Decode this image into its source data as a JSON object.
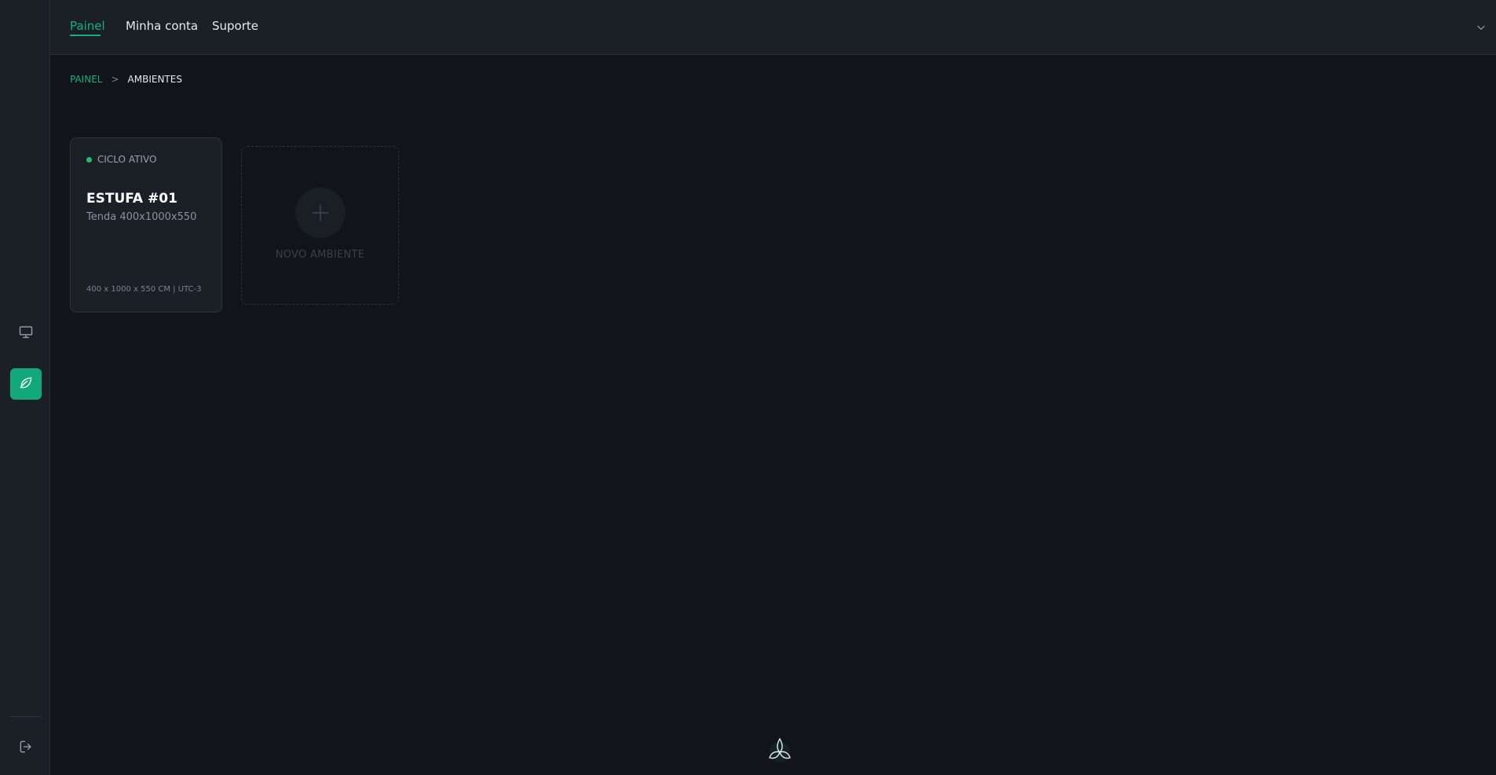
{
  "nav": {
    "tabs": [
      {
        "label": "Painel",
        "active": true
      },
      {
        "label": "Minha conta",
        "active": false
      },
      {
        "label": "Suporte",
        "active": false
      }
    ]
  },
  "sidebar": {
    "items": [
      {
        "icon": "monitor-icon",
        "active": false
      },
      {
        "icon": "leaf-icon",
        "active": true
      }
    ],
    "footer_icon": "logout-icon"
  },
  "breadcrumb": {
    "root": "PAINEL",
    "separator": ">",
    "current": "AMBIENTES"
  },
  "environments": [
    {
      "status": "CICLO ATIVO",
      "name": "ESTUFA #01",
      "subtitle": "Tenda 400x1000x550",
      "footer": "400 x 1000 x 550 CM | UTC-3"
    }
  ],
  "new_environment": {
    "label": "NOVO AMBIENTE"
  },
  "colors": {
    "accent": "#12b07d",
    "background": "#111418",
    "panel": "#1b2027",
    "status_active": "#1fc06d"
  }
}
